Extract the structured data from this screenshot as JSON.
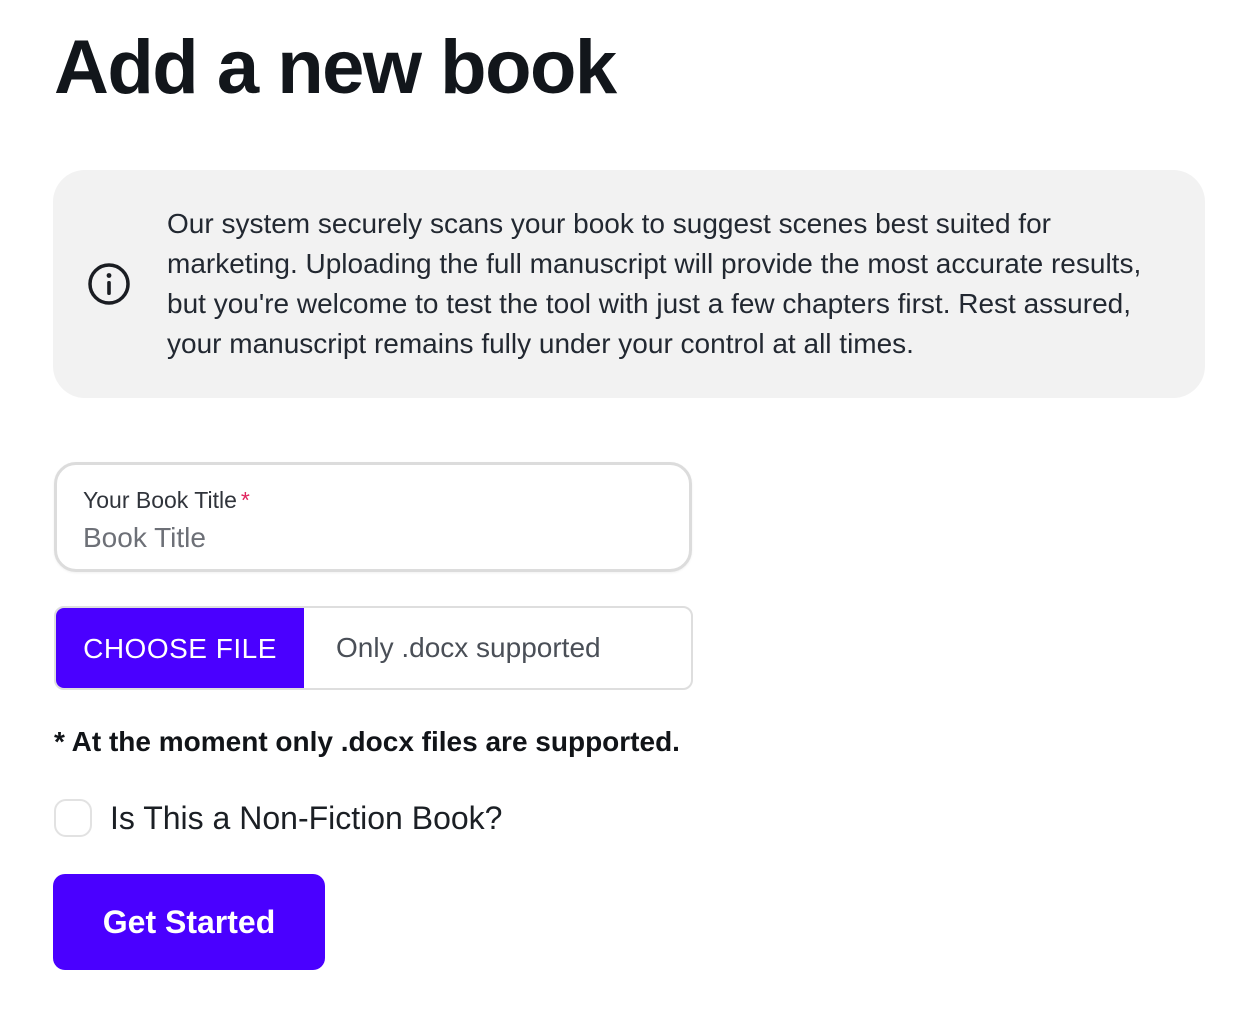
{
  "page": {
    "title": "Add a new book"
  },
  "info": {
    "icon": "info-circle-icon",
    "text": "Our system securely scans your book to suggest scenes best suited for marketing. Uploading the full manuscript will provide the most accurate results, but you're welcome to test the tool with just a few chapters first. Rest assured, your manuscript remains fully under your control at all times."
  },
  "form": {
    "title_field": {
      "label": "Your Book Title",
      "required_mark": "*",
      "placeholder": "Book Title",
      "value": ""
    },
    "file_picker": {
      "button_label": "CHOOSE FILE",
      "status_text": "Only .docx supported"
    },
    "support_note": "* At the moment only .docx files are supported.",
    "nonfiction": {
      "label": "Is This a Non-Fiction Book?",
      "checked": false
    },
    "submit_label": "Get Started"
  },
  "colors": {
    "accent": "#4a00ff",
    "info_background": "#f2f2f2",
    "required": "#e0245e",
    "heading": "#12161b"
  }
}
